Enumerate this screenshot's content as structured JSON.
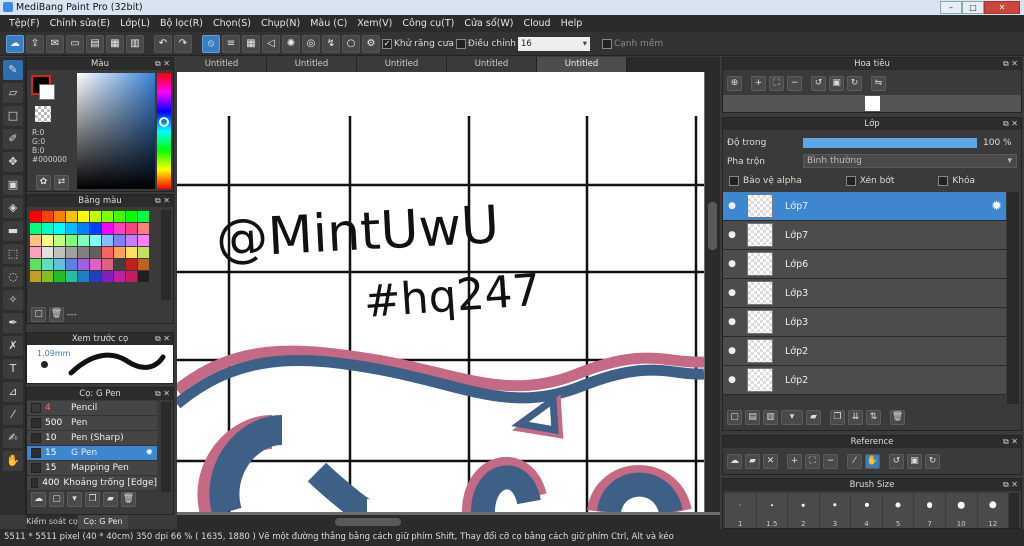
{
  "window": {
    "title": "MediBang Paint Pro (32bit)"
  },
  "menu": [
    "Tệp(F)",
    "Chỉnh sửa(E)",
    "Lớp(L)",
    "Bộ lọc(R)",
    "Chọn(S)",
    "Chụp(N)",
    "Màu (C)",
    "Xem(V)",
    "Công cụ(T)",
    "Cửa sổ(W)",
    "Cloud",
    "Help"
  ],
  "toolbar": {
    "antialias_label": "Khử răng cưa",
    "adjust_label": "Điều chỉnh",
    "adjust_value": "16",
    "snap_label": "Cạnh mềm"
  },
  "doc_tabs": [
    "Untitled",
    "Untitled",
    "Untitled",
    "Untitled",
    "Untitled"
  ],
  "color_panel": {
    "title": "Màu",
    "r": "R:0",
    "g": "G:0",
    "b": "B:0",
    "hex": "#000000",
    "primary": "#000000",
    "secondary": "#ffffff"
  },
  "palette_panel": {
    "title": "Bảng màu",
    "footer": "---",
    "colors": [
      "#ff0000",
      "#ff4000",
      "#ff8000",
      "#ffc000",
      "#ffff00",
      "#c0ff00",
      "#80ff00",
      "#40ff00",
      "#00ff00",
      "#00ff40",
      "#00ff80",
      "#00ffc0",
      "#00ffff",
      "#00c0ff",
      "#0080ff",
      "#0040ff",
      "#ff00ff",
      "#ff40c0",
      "#ff4080",
      "#ff8080",
      "#ffc080",
      "#ffff80",
      "#c0ff80",
      "#80ff80",
      "#80ffc0",
      "#80ffff",
      "#80c0ff",
      "#8080ff",
      "#c080ff",
      "#ff80ff",
      "#ffa0c0",
      "#e0e0e0",
      "#c0c0c0",
      "#a0a0a0",
      "#808080",
      "#606060",
      "#ff6060",
      "#ffa060",
      "#ffe060",
      "#c0e060",
      "#60e060",
      "#60e0c0",
      "#60c0e0",
      "#6080e0",
      "#a060e0",
      "#e060c0",
      "#e06080",
      "#404040",
      "#c02020",
      "#c06020",
      "#c0a020",
      "#80c020",
      "#20c020",
      "#20c0a0",
      "#2080c0",
      "#2040c0",
      "#8020c0",
      "#c020a0",
      "#c02060",
      "#202020"
    ]
  },
  "brush_preview_panel": {
    "title": "Xem trước cọ",
    "size_label": "1.09mm"
  },
  "brush_panel": {
    "title": "Cọ: G Pen",
    "items": [
      {
        "size": "4",
        "name": "Pencil",
        "color": "#ff4040",
        "selected": false
      },
      {
        "size": "500",
        "name": "Pen",
        "color": "#ffffff",
        "selected": false
      },
      {
        "size": "10",
        "name": "Pen (Sharp)",
        "color": "#ffffff",
        "selected": false
      },
      {
        "size": "15",
        "name": "G Pen",
        "color": "#ffffff",
        "selected": true
      },
      {
        "size": "15",
        "name": "Mapping Pen",
        "color": "#ffffff",
        "selected": false
      },
      {
        "size": "400",
        "name": "Khoảng trống [Edge]",
        "color": "#ffffff",
        "selected": false
      }
    ]
  },
  "bottom_tabs": [
    "Kiểm soát cọ",
    "Cọ: G Pen"
  ],
  "navigator_panel": {
    "title": "Hoa tiêu"
  },
  "layer_panel": {
    "title": "Lớp",
    "opacity_label": "Độ trong",
    "opacity_value": "100 %",
    "opacity": 1.0,
    "blend_label": "Pha trộn",
    "blend_value": "Bình thường",
    "protect_alpha": "Bảo vệ alpha",
    "clipping": "Xén bớt",
    "lock": "Khóa",
    "layers": [
      {
        "name": "Lớp7",
        "selected": true
      },
      {
        "name": "Lớp7",
        "selected": false
      },
      {
        "name": "Lớp6",
        "selected": false
      },
      {
        "name": "Lớp3",
        "selected": false
      },
      {
        "name": "Lớp3",
        "selected": false
      },
      {
        "name": "Lớp2",
        "selected": false
      },
      {
        "name": "Lớp2",
        "selected": false
      }
    ]
  },
  "reference_panel": {
    "title": "Reference"
  },
  "brush_size_panel": {
    "title": "Brush Size",
    "sizes": [
      "1",
      "1.5",
      "2",
      "3",
      "4",
      "5",
      "7",
      "10",
      "12"
    ]
  },
  "canvas": {
    "handwriting_line1": "@MintUwU",
    "handwriting_line2": "#hq247"
  },
  "status": {
    "text": "5511 * 5511 pixel  (40 * 40cm)  350 dpi  66 %  ( 1635, 1880 )  Vẽ một đường thẳng bằng cách giữ phím Shift, Thay đổi cỡ cọ bằng cách giữ phím Ctrl, Alt và kéo"
  },
  "colors": {
    "accent": "#3d86d0",
    "stroke_blue": "#3e5f86",
    "stroke_pink": "#c46a84"
  }
}
